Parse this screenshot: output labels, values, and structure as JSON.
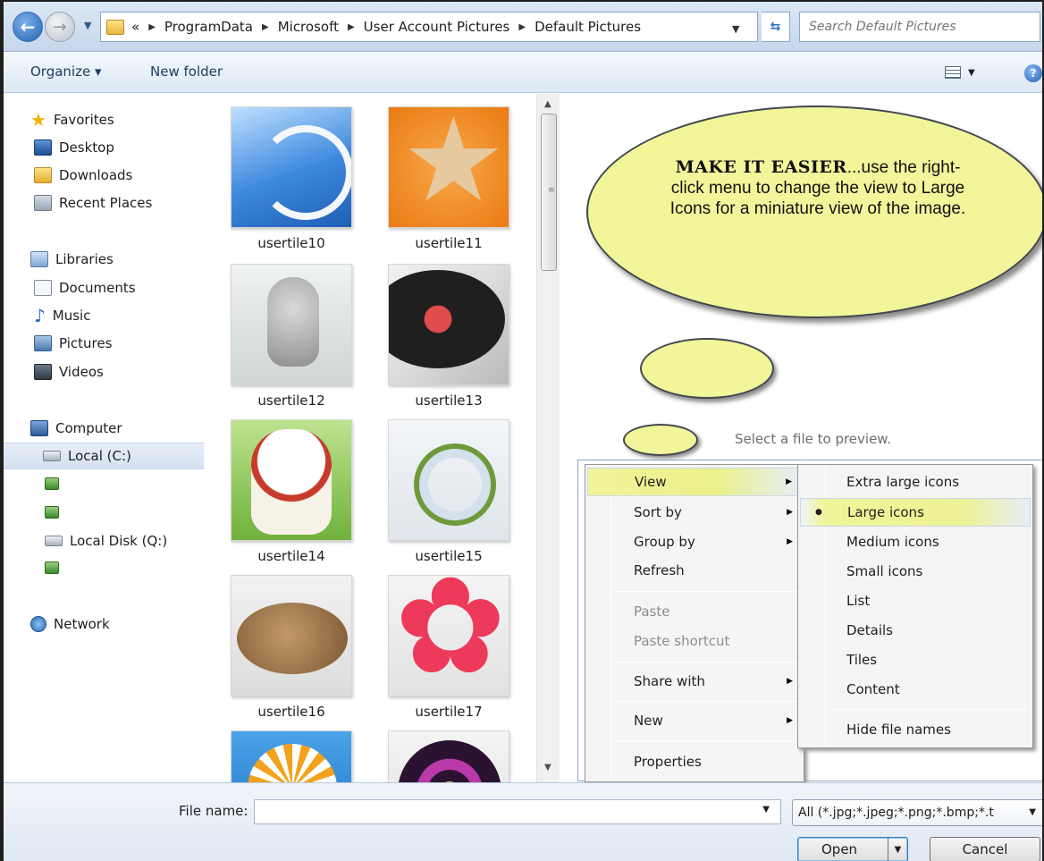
{
  "address": {
    "crumbs": [
      "«",
      "ProgramData",
      "Microsoft",
      "User Account Pictures",
      "Default Pictures"
    ],
    "search_placeholder": "Search Default Pictures"
  },
  "toolbar": {
    "organize_label": "Organize ▾",
    "new_folder_label": "New folder"
  },
  "nav": {
    "favorites": "Favorites",
    "desktop": "Desktop",
    "downloads": "Downloads",
    "recent_places": "Recent Places",
    "libraries": "Libraries",
    "documents": "Documents",
    "music": "Music",
    "pictures": "Pictures",
    "videos": "Videos",
    "computer": "Computer",
    "local_c": "Local (C:)",
    "local_q": "Local Disk (Q:)",
    "network": "Network"
  },
  "files": [
    {
      "label": "usertile10"
    },
    {
      "label": "usertile11"
    },
    {
      "label": "usertile12"
    },
    {
      "label": "usertile13"
    },
    {
      "label": "usertile14"
    },
    {
      "label": "usertile15"
    },
    {
      "label": "usertile16"
    },
    {
      "label": "usertile17"
    }
  ],
  "preview": {
    "callout_strong": "MAKE IT EASIER",
    "callout_rest": "...use the right-click menu to change the view to Large Icons for a miniature view of the image.",
    "hint": "Select a file to preview."
  },
  "context_menu": {
    "items": [
      {
        "label": "View"
      },
      {
        "label": "Sort by"
      },
      {
        "label": "Group by"
      },
      {
        "label": "Refresh"
      },
      {
        "label": "Paste"
      },
      {
        "label": "Paste shortcut"
      },
      {
        "label": "Share with"
      },
      {
        "label": "New"
      },
      {
        "label": "Properties"
      }
    ]
  },
  "view_submenu": {
    "selected": "Large icons",
    "items": [
      {
        "label": "Extra large icons"
      },
      {
        "label": "Large icons"
      },
      {
        "label": "Medium icons"
      },
      {
        "label": "Small icons"
      },
      {
        "label": "List"
      },
      {
        "label": "Details"
      },
      {
        "label": "Tiles"
      },
      {
        "label": "Content"
      },
      {
        "label": "Hide file names"
      }
    ]
  },
  "bottom": {
    "file_name_label": "File name:",
    "file_name_value": "",
    "file_type": "All (*.jpg;*.jpeg;*.png;*.bmp;*.t",
    "open_label": "Open",
    "cancel_label": "Cancel"
  },
  "colors": {
    "callout_fill": "#f2f59a",
    "highlight": "#f3f39a",
    "chrome_blue": "#dce7f4"
  }
}
